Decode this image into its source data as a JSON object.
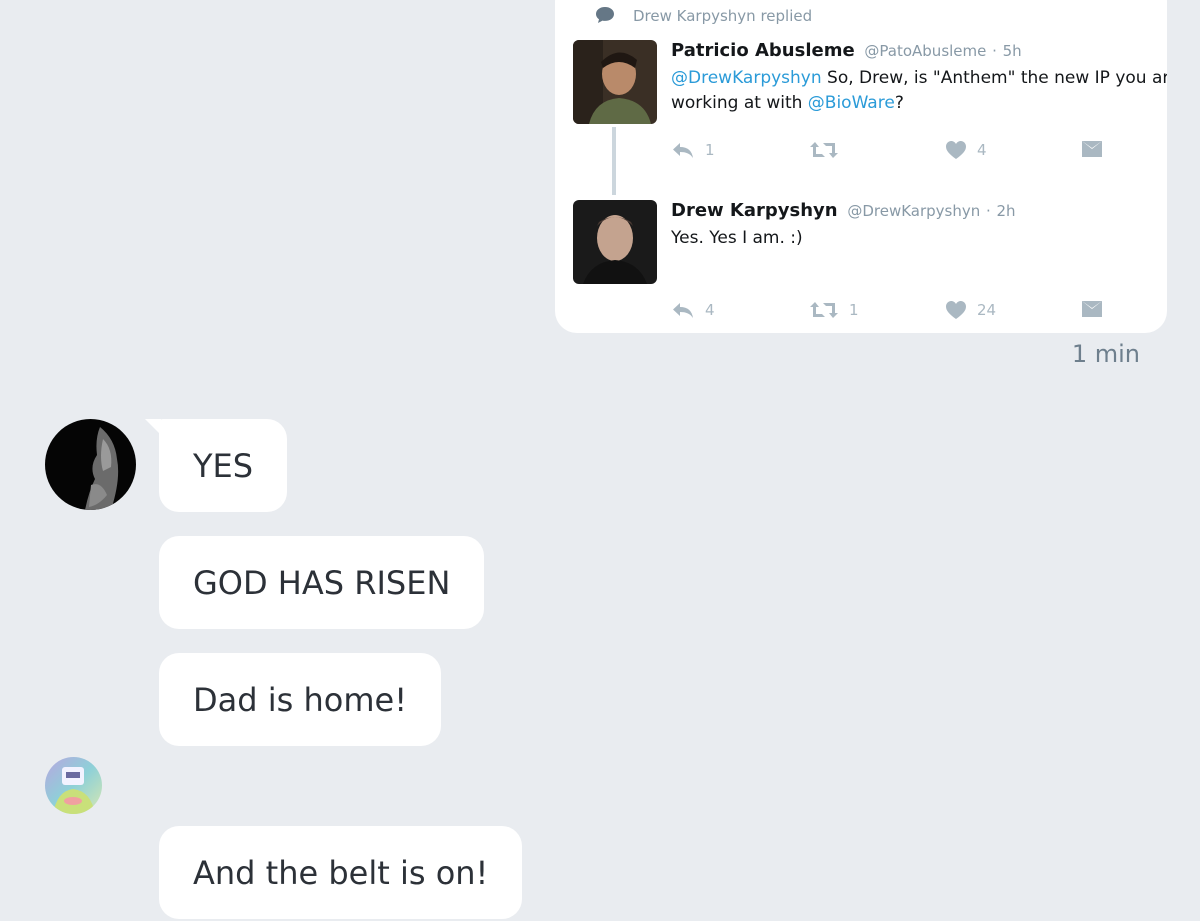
{
  "tweet_card": {
    "reply_context": "Drew Karpyshyn replied",
    "tweets": [
      {
        "name": "Patricio Abusleme",
        "handle": "@PatoAbusleme",
        "separator": "·",
        "time": "5h",
        "body_line1": {
          "mention": "@DrewKarpyshyn",
          "text": " So, Drew, is \"Anthem\" the new IP you are"
        },
        "body_line2": {
          "text_before": "working at with ",
          "mention": "@BioWare",
          "text_after": "?"
        },
        "reply_count": "1",
        "retweet_count": "",
        "like_count": "4"
      },
      {
        "name": "Drew Karpyshyn",
        "handle": "@DrewKarpyshyn",
        "separator": "·",
        "time": "2h",
        "body": "Yes. Yes I am. :)",
        "reply_count": "4",
        "retweet_count": "1",
        "like_count": "24"
      }
    ],
    "sent_time": "1 min"
  },
  "messages": [
    {
      "text": "YES"
    },
    {
      "text": "GOD HAS RISEN"
    },
    {
      "text": "Dad is home!"
    },
    {
      "text": "And the belt is on!"
    }
  ],
  "icons": {
    "reply": "reply-arrow-icon",
    "retweet": "retweet-icon",
    "like": "heart-icon",
    "dm": "envelope-icon",
    "replied": "speech-bubble-icon"
  },
  "colors": {
    "background": "#e9ecf0",
    "card": "#ffffff",
    "mention": "#2b9bd8",
    "muted": "#8899a6",
    "action_icon": "#aab8c2"
  }
}
